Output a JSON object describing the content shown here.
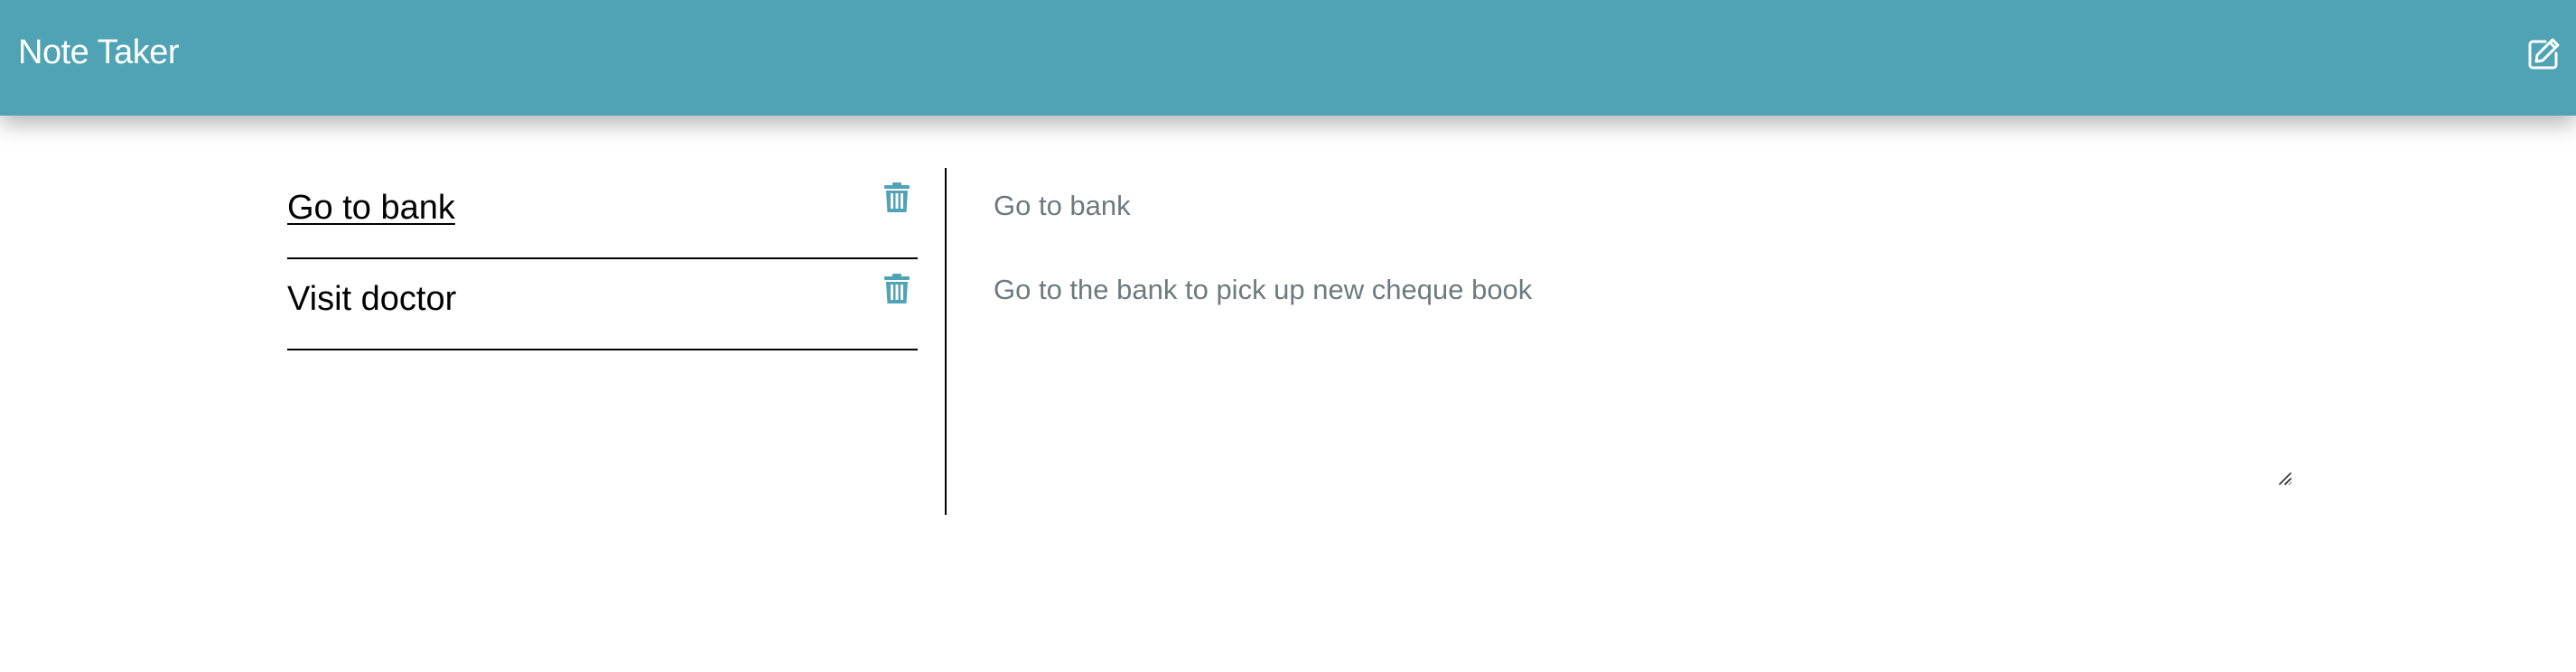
{
  "app": {
    "title": "Note Taker",
    "accent_color": "#4fa3b5"
  },
  "header": {
    "new_note_icon": "edit-square-icon"
  },
  "notes": [
    {
      "title": "Go to bank",
      "active": true,
      "delete_icon": "trash-icon"
    },
    {
      "title": "Visit doctor",
      "active": false,
      "delete_icon": "trash-icon"
    }
  ],
  "editor": {
    "title_value": "Go to bank",
    "body_value": "Go to the bank to pick up new cheque book"
  }
}
